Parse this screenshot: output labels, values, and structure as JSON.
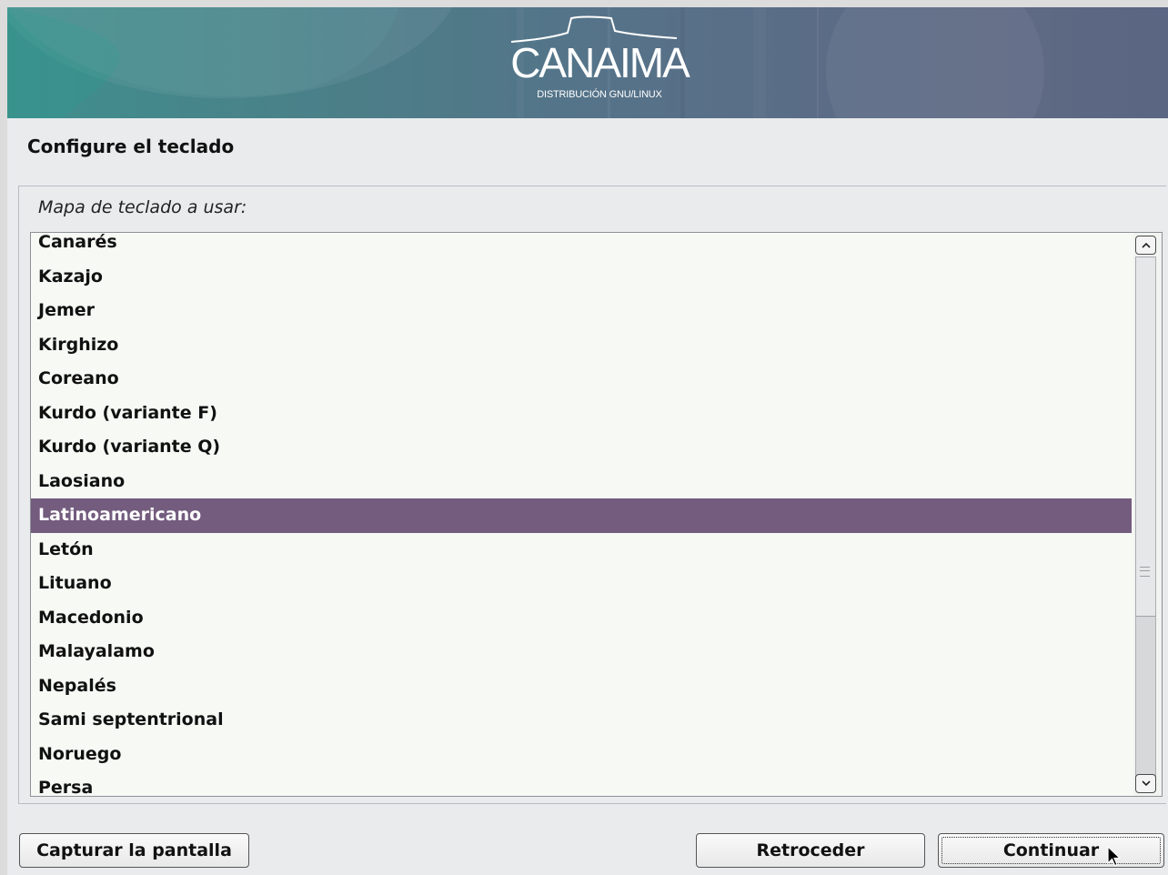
{
  "header": {
    "logo_text": "CANAIMA",
    "logo_subtitle": "DISTRIBUCIÓN GNU/LINUX"
  },
  "page": {
    "title": "Configure el teclado"
  },
  "keymap": {
    "label": "Mapa de teclado a usar:",
    "items": [
      "Canarés",
      "Kazajo",
      "Jemer",
      "Kirghizo",
      "Coreano",
      "Kurdo (variante F)",
      "Kurdo (variante Q)",
      "Laosiano",
      "Latinoamericano",
      "Letón",
      "Lituano",
      "Macedonio",
      "Malayalamo",
      "Nepalés",
      "Sami septentrional",
      "Noruego",
      "Persa"
    ],
    "selected": "Latinoamericano",
    "scroll_up_icon": "chevron-up-icon",
    "scroll_down_icon": "chevron-down-icon"
  },
  "buttons": {
    "screenshot": "Capturar la pantalla",
    "back": "Retroceder",
    "continue": "Continuar"
  },
  "colors": {
    "selection": "#735c7e",
    "banner_left": "#3f8f8d",
    "banner_right": "#5a6682"
  }
}
